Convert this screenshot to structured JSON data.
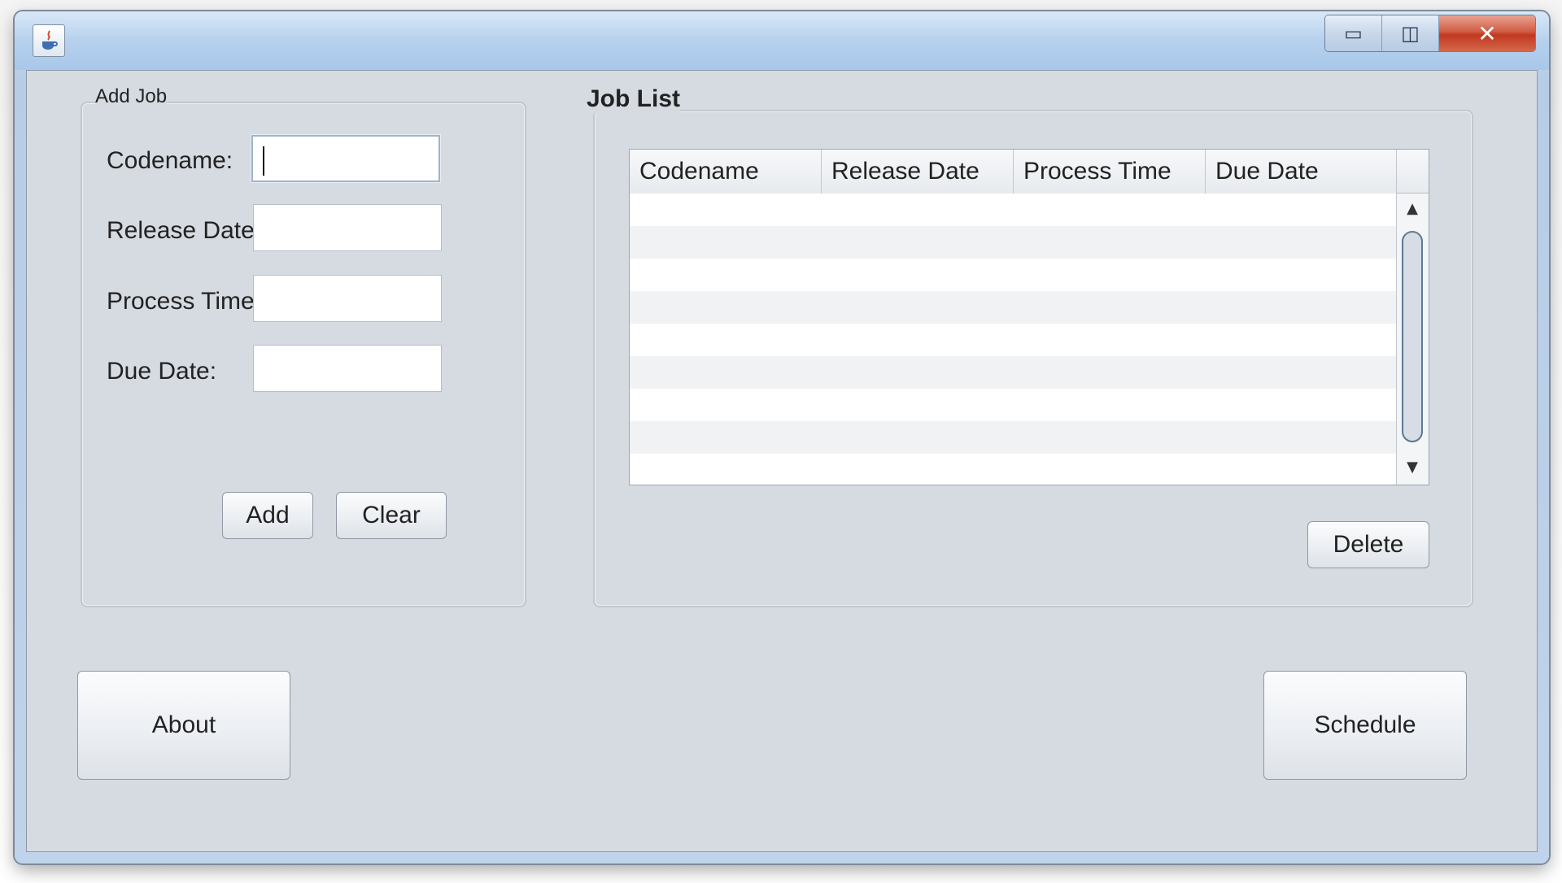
{
  "window": {
    "icon": "java-cup-icon",
    "controls": {
      "minimize_glyph": "▭",
      "maximize_glyph": "◫",
      "close_glyph": "✕"
    }
  },
  "add_job": {
    "title": "Add Job",
    "fields": [
      {
        "label": "Codename:",
        "value": "",
        "placeholder": ""
      },
      {
        "label": "Release Date:",
        "value": "",
        "placeholder": ""
      },
      {
        "label": "Process Time:",
        "value": "",
        "placeholder": ""
      },
      {
        "label": "Due Date:",
        "value": "",
        "placeholder": ""
      }
    ],
    "add_label": "Add",
    "clear_label": "Clear"
  },
  "job_list": {
    "title": "Job List",
    "columns": [
      "Codename",
      "Release Date",
      "Process Time",
      "Due Date"
    ],
    "rows": [],
    "delete_label": "Delete",
    "scroll_up_glyph": "▲",
    "scroll_down_glyph": "▼"
  },
  "footer": {
    "about_label": "About",
    "schedule_label": "Schedule"
  },
  "colors": {
    "window_client": "#d6dbe2",
    "titlebar": "#b6d1ee",
    "close_button": "#c0381f"
  }
}
